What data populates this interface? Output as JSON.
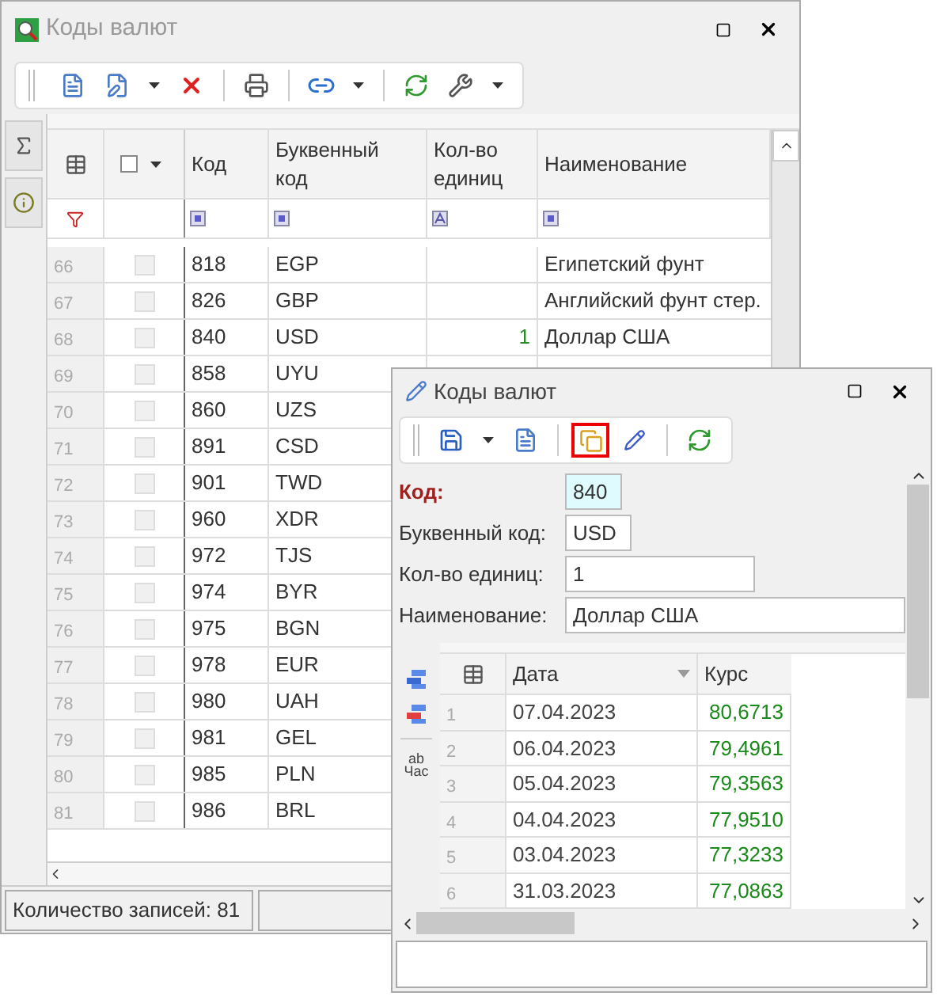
{
  "main_window": {
    "title": "Коды валют",
    "select_all_checked": false,
    "columns": [
      "Код",
      "Буквенный\nкод",
      "Кол-во\nединиц",
      "Наименование"
    ],
    "rows": [
      {
        "num": "66",
        "checked": false,
        "code": "818",
        "alpha": "EGP",
        "name": "Египетский фунт"
      },
      {
        "num": "67",
        "checked": false,
        "code": "826",
        "alpha": "GBP",
        "name": "Английский фунт стер."
      },
      {
        "num": "68",
        "checked": false,
        "code": "840",
        "alpha": "USD",
        "units": "1",
        "name": "Доллар США"
      },
      {
        "num": "69",
        "checked": false,
        "code": "858",
        "alpha": "UYU"
      },
      {
        "num": "70",
        "checked": false,
        "code": "860",
        "alpha": "UZS"
      },
      {
        "num": "71",
        "checked": false,
        "code": "891",
        "alpha": "CSD"
      },
      {
        "num": "72",
        "checked": false,
        "code": "901",
        "alpha": "TWD"
      },
      {
        "num": "73",
        "checked": false,
        "code": "960",
        "alpha": "XDR"
      },
      {
        "num": "74",
        "checked": false,
        "code": "972",
        "alpha": "TJS"
      },
      {
        "num": "75",
        "checked": false,
        "code": "974",
        "alpha": "BYR"
      },
      {
        "num": "76",
        "checked": false,
        "code": "975",
        "alpha": "BGN"
      },
      {
        "num": "77",
        "checked": false,
        "code": "978",
        "alpha": "EUR"
      },
      {
        "num": "78",
        "checked": false,
        "code": "980",
        "alpha": "UAH"
      },
      {
        "num": "79",
        "checked": false,
        "code": "981",
        "alpha": "GEL"
      },
      {
        "num": "80",
        "checked": false,
        "code": "985",
        "alpha": "PLN"
      },
      {
        "num": "81",
        "checked": false,
        "code": "986",
        "alpha": "BRL"
      }
    ],
    "status_bar": "Количество записей: 81"
  },
  "edit_window": {
    "title": "Коды валют",
    "fields": [
      {
        "label": "Код:",
        "value": "840",
        "kind": "key"
      },
      {
        "label": "Буквенный код:",
        "value": "USD",
        "kind": "short"
      },
      {
        "label": "Кол-во единиц:",
        "value": "1",
        "kind": "medium"
      },
      {
        "label": "Наименование:",
        "value": "Доллар США",
        "kind": "wide"
      }
    ],
    "format_icon_label": [
      "ab",
      "Час"
    ],
    "columns": [
      "Дата",
      "Курс"
    ],
    "rates": [
      {
        "num": "1",
        "date": "07.04.2023",
        "rate": "80,6713"
      },
      {
        "num": "2",
        "date": "06.04.2023",
        "rate": "79,4961"
      },
      {
        "num": "3",
        "date": "05.04.2023",
        "rate": "79,3563"
      },
      {
        "num": "4",
        "date": "04.04.2023",
        "rate": "77,9510"
      },
      {
        "num": "5",
        "date": "03.04.2023",
        "rate": "77,3233"
      },
      {
        "num": "6",
        "date": "31.03.2023",
        "rate": "77,0863"
      }
    ]
  }
}
